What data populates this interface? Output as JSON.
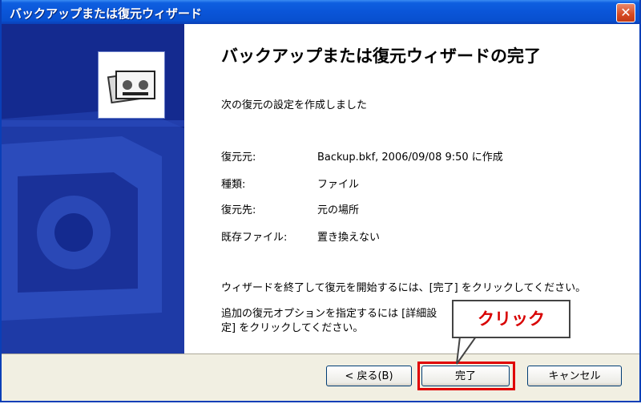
{
  "window": {
    "title": "バックアップまたは復元ウィザード",
    "close_glyph": "✕"
  },
  "content": {
    "heading": "バックアップまたは復元ウィザードの完了",
    "subtext": "次の復元の設定を作成しました",
    "rows": [
      {
        "label": "復元元:",
        "value": "Backup.bkf, 2006/09/08 9:50 に作成"
      },
      {
        "label": "種類:",
        "value": "ファイル"
      },
      {
        "label": "復元先:",
        "value": "元の場所"
      },
      {
        "label": "既存ファイル:",
        "value": "置き換えない"
      }
    ],
    "finish_note": "ウィザードを終了して復元を開始するには、[完了] をクリックしてください。",
    "advanced_note_line1": "追加の復元オプションを指定するには [詳細設",
    "advanced_note_line2": "定] をクリックしてください。"
  },
  "buttons": {
    "back": "< 戻る(B)",
    "finish": "完了",
    "cancel": "キャンセル"
  },
  "annotation": {
    "callout_text": "クリック",
    "highlight_color": "#e00000"
  },
  "icons": {
    "panel_icon": "backup-tape-icon"
  }
}
